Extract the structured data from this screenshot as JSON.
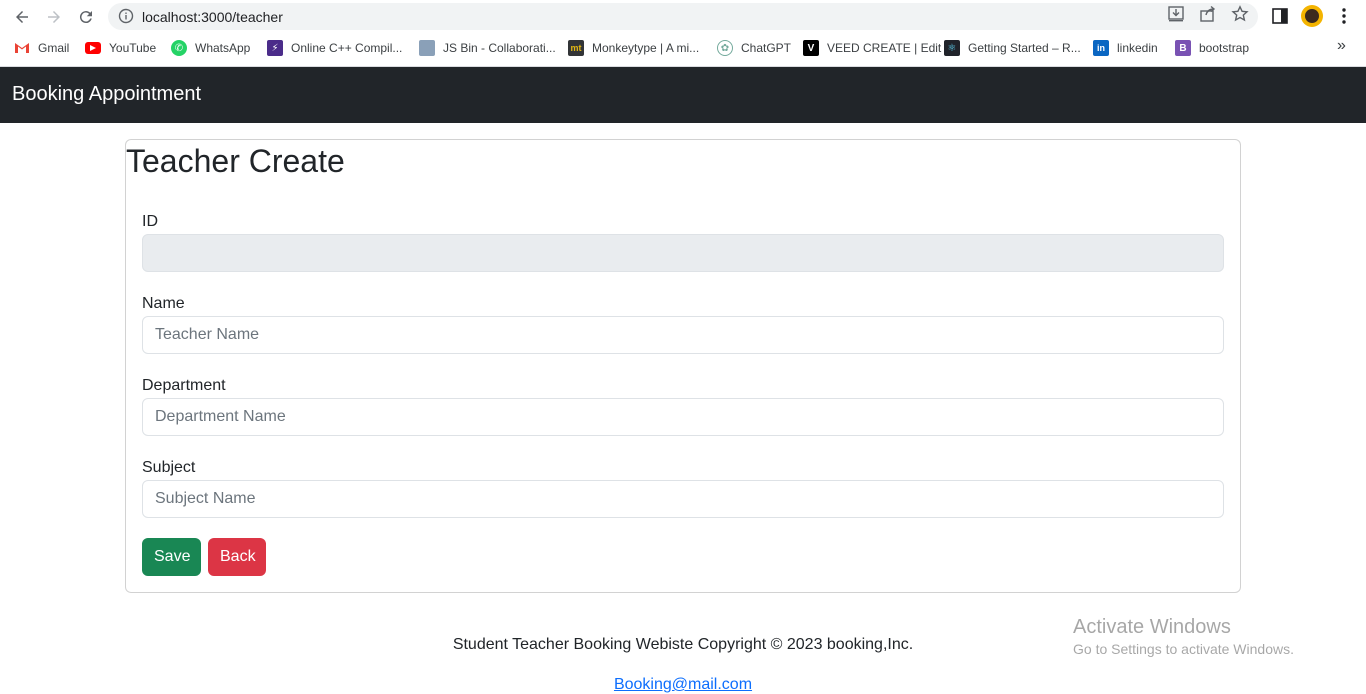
{
  "browser": {
    "url": "localhost:3000/teacher",
    "bookmarks": [
      {
        "label": "Gmail",
        "icon": "gmail-icon"
      },
      {
        "label": "YouTube",
        "icon": "youtube-icon"
      },
      {
        "label": "WhatsApp",
        "icon": "whatsapp-icon"
      },
      {
        "label": "Online C++ Compil...",
        "icon": "compiler-icon"
      },
      {
        "label": "JS Bin - Collaborati...",
        "icon": "jsbin-icon"
      },
      {
        "label": "Monkeytype | A mi...",
        "icon": "monkeytype-icon"
      },
      {
        "label": "ChatGPT",
        "icon": "chatgpt-icon"
      },
      {
        "label": "VEED CREATE | Edit",
        "icon": "veed-icon"
      },
      {
        "label": "Getting Started – R...",
        "icon": "react-icon"
      },
      {
        "label": "linkedin",
        "icon": "linkedin-icon"
      },
      {
        "label": "bootstrap",
        "icon": "bootstrap-icon"
      }
    ],
    "more_label": "»"
  },
  "navbar": {
    "brand": "Booking Appointment"
  },
  "form": {
    "title": "Teacher Create",
    "id_label": "ID",
    "id_value": "",
    "name_label": "Name",
    "name_placeholder": "Teacher Name",
    "department_label": "Department",
    "department_placeholder": "Department Name",
    "subject_label": "Subject",
    "subject_placeholder": "Subject Name",
    "save_label": "Save",
    "back_label": "Back"
  },
  "footer": {
    "copyright": "Student Teacher Booking Webiste Copyright © 2023 booking,Inc.",
    "email": "Booking@mail.com"
  },
  "watermark": {
    "title": "Activate Windows",
    "subtitle": "Go to Settings to activate Windows."
  },
  "colors": {
    "navbar": "#212529",
    "save": "#198754",
    "back": "#dc3545",
    "link": "#0d6efd"
  }
}
